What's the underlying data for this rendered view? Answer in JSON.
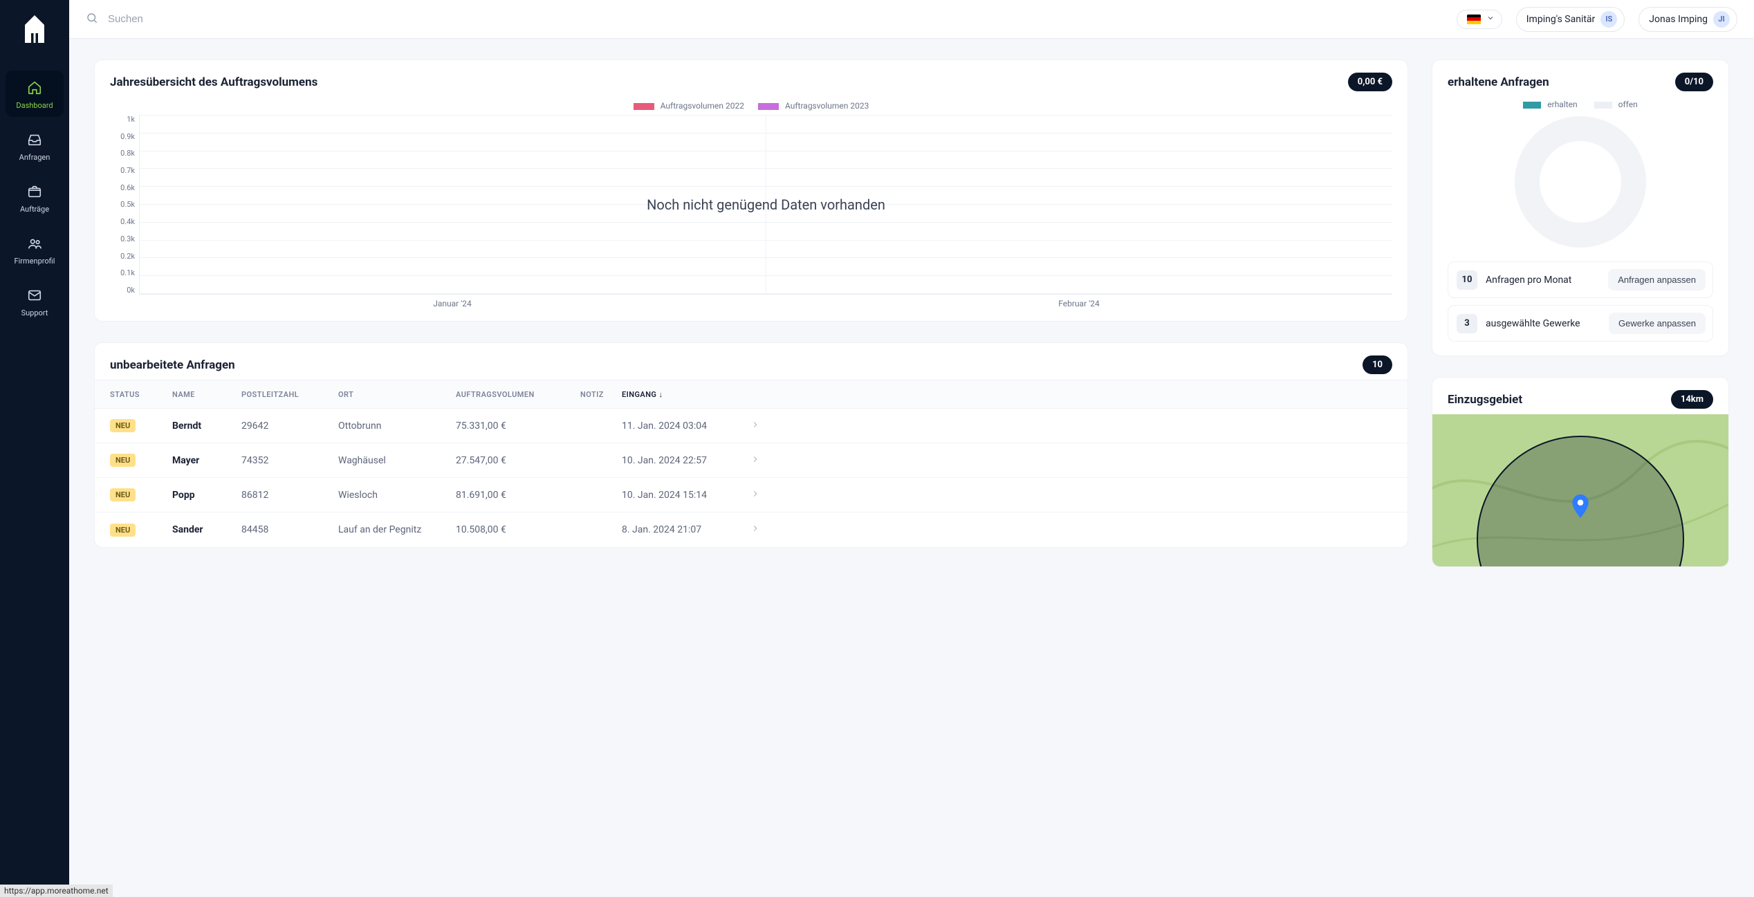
{
  "status_bar_url": "https://app.moreathome.net",
  "sidebar": {
    "items": [
      {
        "label": "Dashboard",
        "icon": "home-icon",
        "active": true
      },
      {
        "label": "Anfragen",
        "icon": "inbox-icon",
        "active": false
      },
      {
        "label": "Aufträge",
        "icon": "box-icon",
        "active": false
      },
      {
        "label": "Firmenprofil",
        "icon": "users-icon",
        "active": false
      },
      {
        "label": "Support",
        "icon": "mail-icon",
        "active": false
      }
    ]
  },
  "topbar": {
    "search_placeholder": "Suchen",
    "language_flag": "de",
    "company": {
      "name": "Imping's Sanitär",
      "initials": "IS"
    },
    "user": {
      "name": "Jonas Imping",
      "initials": "JI"
    }
  },
  "colors": {
    "series2022": "#e85a7a",
    "series2023": "#c76edc",
    "donut_erhalten": "#2f9ba3",
    "donut_offen": "#eceff4"
  },
  "overview_chart": {
    "title": "Jahresübersicht des Auftragsvolumens",
    "badge": "0,00 €",
    "legend": [
      "Auftragsvolumen 2022",
      "Auftragsvolumen 2023"
    ],
    "empty_message": "Noch nicht genügend Daten vorhanden"
  },
  "chart_data": {
    "type": "bar",
    "title": "Jahresübersicht des Auftragsvolumens",
    "xlabel": "",
    "ylabel": "",
    "ylim": [
      0,
      1000
    ],
    "y_ticks": [
      "1k",
      "0.9k",
      "0.8k",
      "0.7k",
      "0.6k",
      "0.5k",
      "0.4k",
      "0.3k",
      "0.2k",
      "0.1k",
      "0k"
    ],
    "categories": [
      "Januar '24",
      "Februar '24"
    ],
    "series": [
      {
        "name": "Auftragsvolumen 2022",
        "values": [
          0,
          0
        ]
      },
      {
        "name": "Auftragsvolumen 2023",
        "values": [
          0,
          0
        ]
      }
    ],
    "note": "Noch nicht genügend Daten vorhanden"
  },
  "requests_card": {
    "title": "erhaltene Anfragen",
    "badge": "0/10",
    "legend": {
      "received": "erhalten",
      "open": "offen"
    },
    "donut": {
      "received": 0,
      "open": 10
    },
    "stats": [
      {
        "count": "10",
        "label": "Anfragen pro Monat",
        "action": "Anfragen anpassen"
      },
      {
        "count": "3",
        "label": "ausgewählte Gewerke",
        "action": "Gewerke anpassen"
      }
    ]
  },
  "table": {
    "title": "unbearbeitete Anfragen",
    "badge": "10",
    "columns": {
      "status": "STATUS",
      "name": "NAME",
      "plz": "POSTLEITZAHL",
      "ort": "ORT",
      "volumen": "AUFTRAGSVOLUMEN",
      "notiz": "NOTIZ",
      "eingang": "EINGANG",
      "sort_indicator": "↓"
    },
    "status_label": "NEU",
    "rows": [
      {
        "name": "Berndt",
        "plz": "29642",
        "ort": "Ottobrunn",
        "volumen": "75.331,00 €",
        "eingang": "11. Jan. 2024 03:04"
      },
      {
        "name": "Mayer",
        "plz": "74352",
        "ort": "Waghäusel",
        "volumen": "27.547,00 €",
        "eingang": "10. Jan. 2024 22:57"
      },
      {
        "name": "Popp",
        "plz": "86812",
        "ort": "Wiesloch",
        "volumen": "81.691,00 €",
        "eingang": "10. Jan. 2024 15:14"
      },
      {
        "name": "Sander",
        "plz": "84458",
        "ort": "Lauf an der Pegnitz",
        "volumen": "10.508,00 €",
        "eingang": "8. Jan. 2024 21:07"
      }
    ]
  },
  "map_card": {
    "title": "Einzugsgebiet",
    "badge": "14km"
  }
}
